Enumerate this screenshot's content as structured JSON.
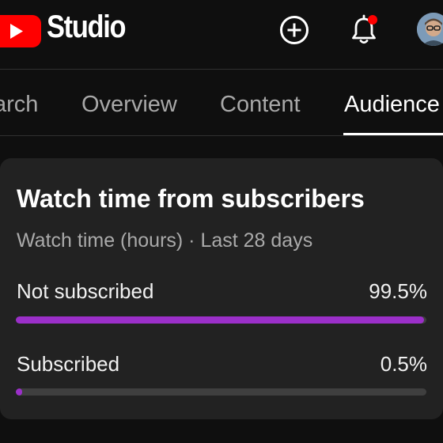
{
  "app": {
    "title": "Studio",
    "brand_color": "#ff0000"
  },
  "header": {
    "icons": [
      "youtube-logo-icon",
      "create-icon",
      "notifications-bell-icon",
      "avatar"
    ],
    "notification_dot_color": "#ff0000"
  },
  "tabs": [
    {
      "label": "arch",
      "active": false
    },
    {
      "label": "Overview",
      "active": false
    },
    {
      "label": "Content",
      "active": false
    },
    {
      "label": "Audience",
      "active": true
    }
  ],
  "card": {
    "title": "Watch time from subscribers",
    "subtitle": "Watch time (hours) · Last 28 days",
    "rows": [
      {
        "label": "Not subscribed",
        "value": "99.5%",
        "fraction": 0.995
      },
      {
        "label": "Subscribed",
        "value": "0.5%",
        "fraction": 0.005
      }
    ],
    "bar_color": "#9b2fc9",
    "track_color": "#3f3f3f"
  }
}
